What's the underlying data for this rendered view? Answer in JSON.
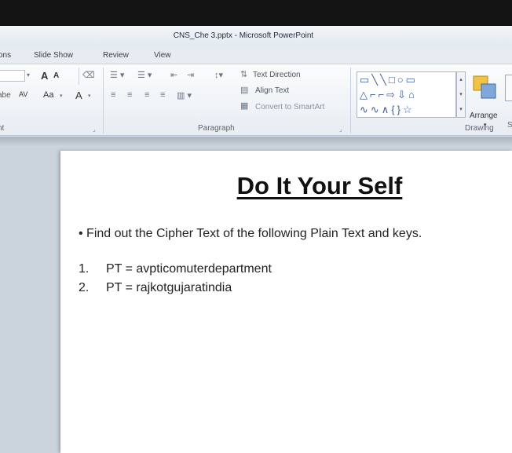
{
  "window": {
    "title": "CNS_Che 3.pptx  -  Microsoft PowerPoint"
  },
  "tabs": [
    {
      "label": "ons"
    },
    {
      "label": "Slide Show"
    },
    {
      "label": "Review"
    },
    {
      "label": "View"
    }
  ],
  "ribbon": {
    "font_group": {
      "label": "nt",
      "grow_font": "A",
      "shrink_font": "A",
      "strike_sample": "abe",
      "char_spacing": "AV",
      "change_case": "Aa",
      "font_color": "A"
    },
    "paragraph_group": {
      "label": "Paragraph",
      "text_direction": "Text Direction",
      "align_text": "Align Text",
      "convert_smartart": "Convert to SmartArt"
    },
    "drawing_group": {
      "label": "Drawing",
      "arrange": "Arrange",
      "partial": "S"
    }
  },
  "slide": {
    "title": "Do It Your Self",
    "bullet": "• Find out the Cipher Text of the following Plain Text and keys.",
    "items": [
      {
        "num": "1.",
        "text": "PT = avpticomuterdepartment"
      },
      {
        "num": "2.",
        "text": "PT = rajkotgujaratindia"
      }
    ]
  },
  "colors": {
    "ribbon_bg": "#f3f6f9",
    "workspace_bg": "#cbd3dc",
    "slide_bg": "#ffffff",
    "shape_blue": "#3e5f95"
  }
}
